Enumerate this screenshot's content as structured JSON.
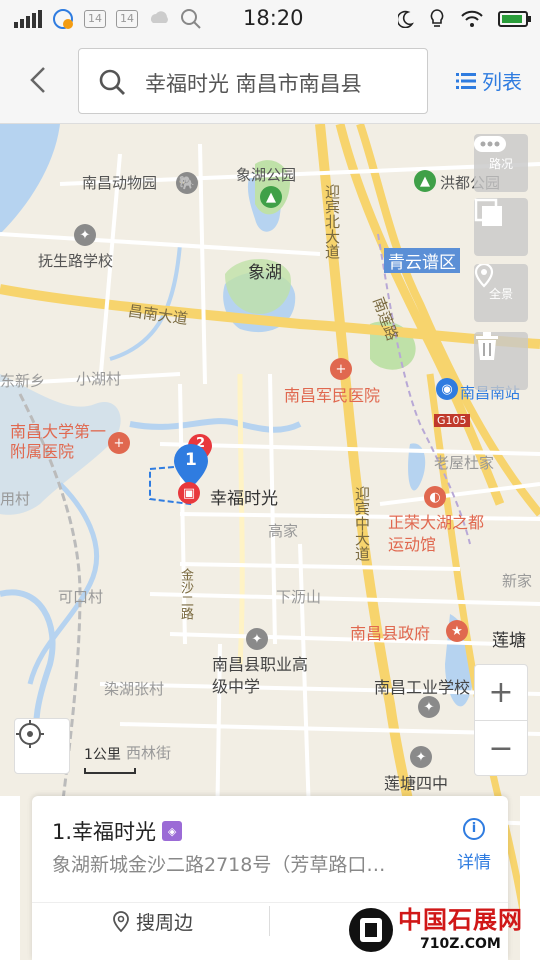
{
  "status_bar": {
    "time": "18:20",
    "badges": [
      "14",
      "14"
    ]
  },
  "search": {
    "query": "幸福时光 南昌市南昌县",
    "list_label": "列表"
  },
  "map": {
    "labels": {
      "nanchang_zoo": "南昌动物园",
      "xianghu_park": "象湖公园",
      "hongdu_park": "洪都公园",
      "fusheng_school": "抚生路学校",
      "xianghu": "象湖",
      "qingyunpu": "青云谱区",
      "changnan_avenue": "昌南大道",
      "nanlian_road": "南莲路",
      "yingbin_north": "迎宾北大道",
      "dongxin": "东新乡",
      "xiaohu": "小湖村",
      "army_hospital": "南昌军民医院",
      "nanchang_south": "南昌南站",
      "g105": "G105",
      "ncu_hospital": "南昌大学第一附属医院",
      "laoyan": "老屋杜家",
      "xingfu": "幸福时光",
      "zhengrong": "正荣大湖之都运动馆",
      "yongcun": "用村",
      "gaojia": "高家",
      "yingbin_middle": "迎宾中大道",
      "jinsha2": "金沙二路",
      "xialishan": "下沥山",
      "kekou": "可口村",
      "county_gov": "南昌县政府",
      "liantang": "莲塘",
      "xinjia": "新家",
      "vocational": "南昌县职业高级中学",
      "ranhu": "染湖张村",
      "industrial": "南昌工业学校",
      "xilin": "西林街",
      "liantang_4": "莲塘四中"
    },
    "buttons": {
      "traffic": "路况",
      "panorama": "全景"
    },
    "pins": {
      "pin1": "1",
      "pin2": "2"
    },
    "scale": "1公里",
    "zoom_in": "+",
    "zoom_out": "−"
  },
  "card": {
    "title": "1.幸福时光",
    "address": "象湖新城金沙二路2718号（芳草路口…",
    "detail_label": "详情",
    "nearby_label": "搜周边"
  },
  "watermark": {
    "name": "中国石展网",
    "url": "710Z.COM"
  }
}
